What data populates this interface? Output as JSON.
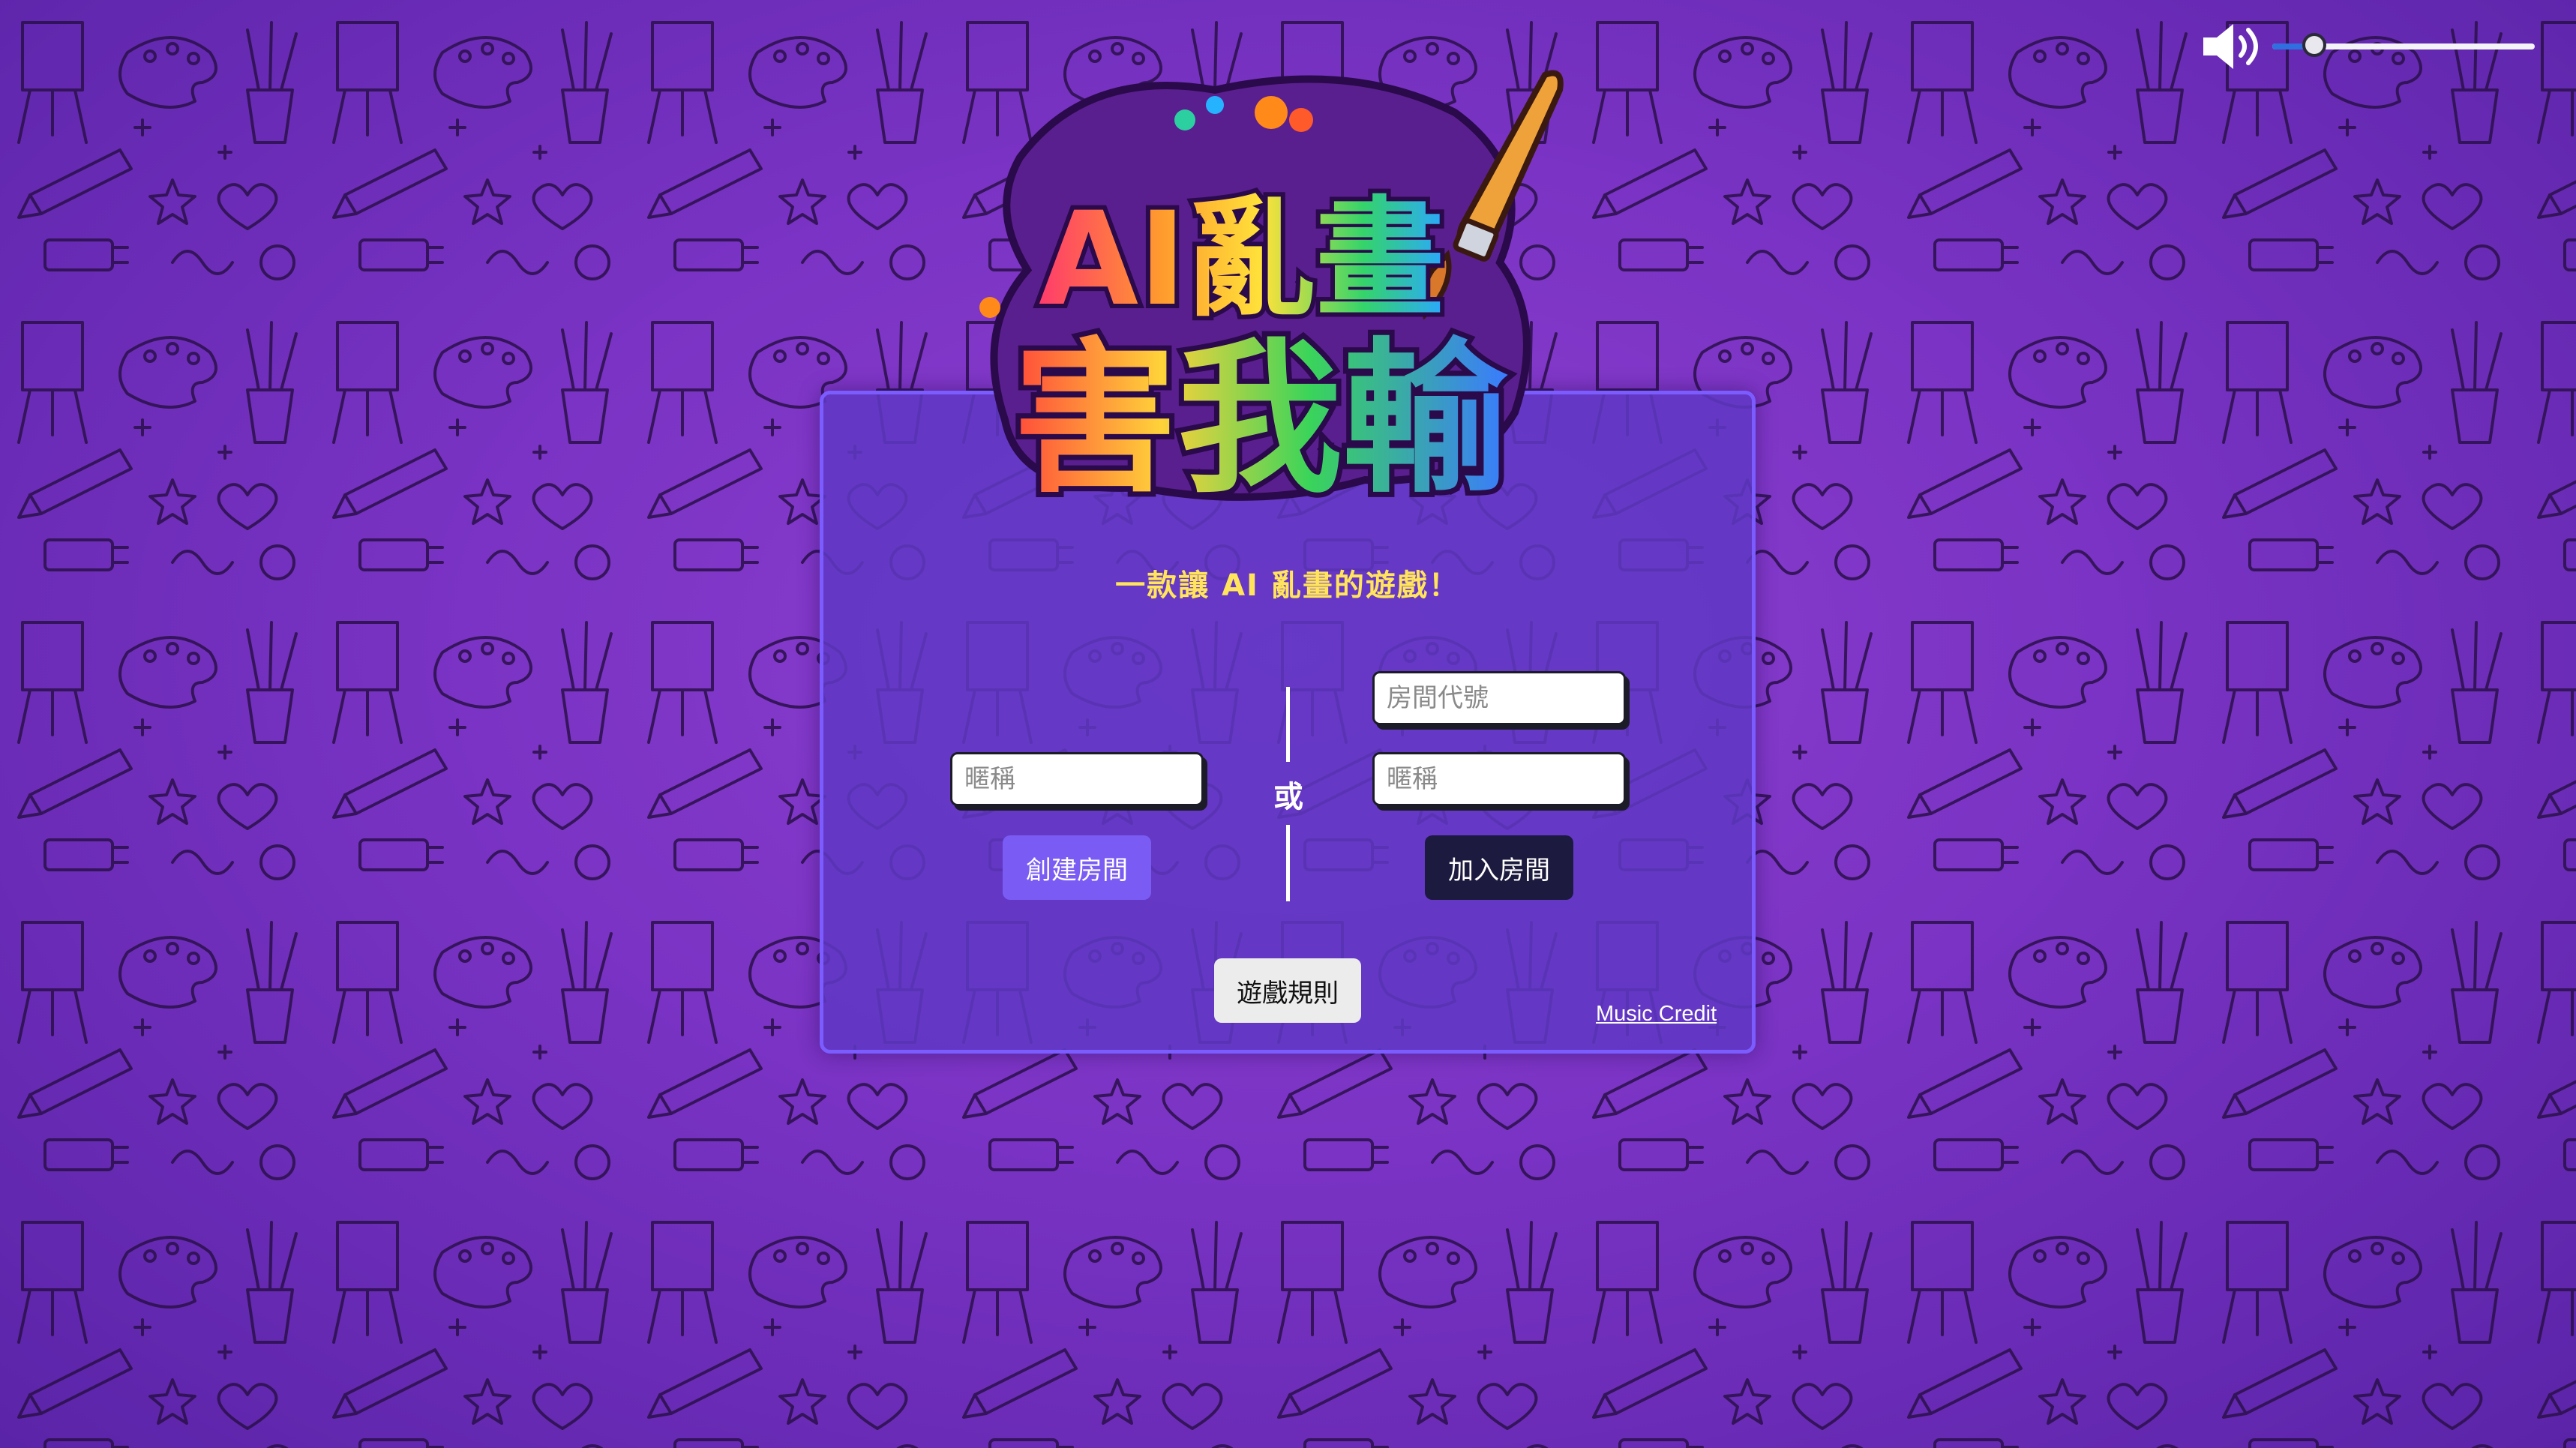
{
  "logo": {
    "line1": "AI亂畫",
    "line2": "害我輸"
  },
  "tagline": "一款讓 AI 亂畫的遊戲！",
  "create": {
    "nickname_placeholder": "暱稱",
    "button_label": "創建房間"
  },
  "divider": {
    "label": "或"
  },
  "join": {
    "room_code_placeholder": "房間代號",
    "nickname_placeholder": "暱稱",
    "button_label": "加入房間"
  },
  "rules_button_label": "遊戲規則",
  "music_credit_label": "Music Credit",
  "volume": {
    "level": 0.16
  },
  "colors": {
    "background": "#7a33c4",
    "card": "#6038c4",
    "card_border": "#7b5cff",
    "tagline": "#ffe45c",
    "create_button": "#7a5cf5",
    "join_button": "#1c1a3e",
    "rules_button": "#ececec",
    "volume_fill": "#2f6fe0"
  },
  "icons": {
    "volume": "speaker-high-icon",
    "logo_brush": "paintbrush-icon"
  }
}
